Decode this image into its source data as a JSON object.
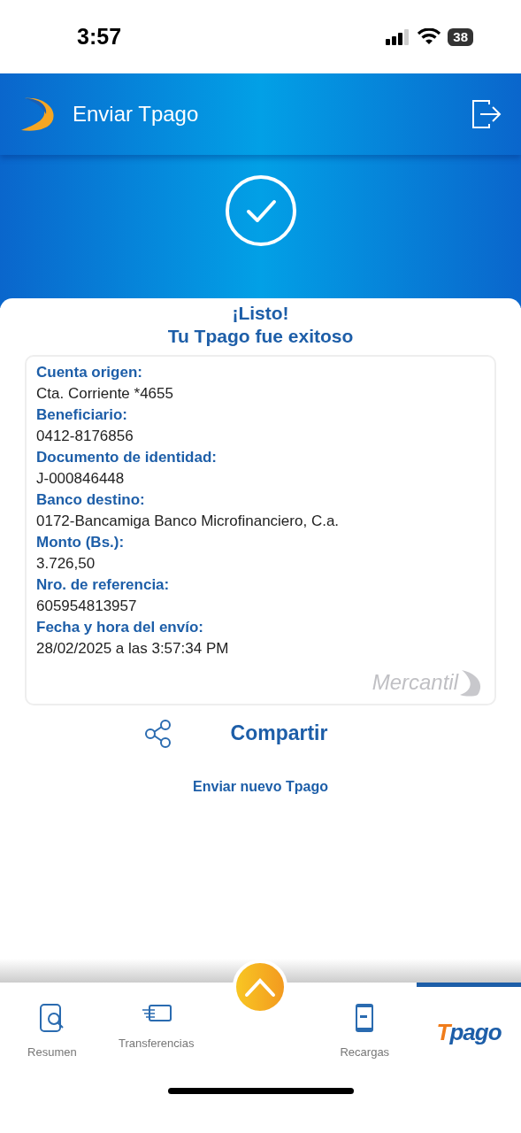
{
  "status_bar": {
    "time": "3:57",
    "battery": "38"
  },
  "header": {
    "title": "Enviar Tpago"
  },
  "result": {
    "heading": "¡Listo!",
    "subheading": "Tu Tpago fue exitoso"
  },
  "details": [
    {
      "label": "Cuenta origen:",
      "value": "Cta. Corriente *4655"
    },
    {
      "label": "Beneficiario:",
      "value": "0412-8176856"
    },
    {
      "label": "Documento de identidad:",
      "value": "J-000846448"
    },
    {
      "label": "Banco destino:",
      "value": "0172-Bancamiga Banco Microfinanciero, C.a."
    },
    {
      "label": "Monto (Bs.):",
      "value": "3.726,50"
    },
    {
      "label": "Nro. de referencia:",
      "value": "605954813957"
    },
    {
      "label": "Fecha y hora del envío:",
      "value": "28/02/2025 a las 3:57:34 PM"
    }
  ],
  "watermark_brand": "Mercantil",
  "share_button": "Compartir",
  "new_link": "Enviar nuevo Tpago",
  "tab_bar": [
    {
      "kind": "summary",
      "label": "Resumen",
      "selected": false
    },
    {
      "kind": "transfer",
      "label": "Transferencias",
      "selected": false
    },
    {
      "kind": "center",
      "selected": false
    },
    {
      "kind": "recharge",
      "label": "Recargas",
      "selected": false
    },
    {
      "kind": "logo",
      "label": "Tpago",
      "selected": true
    }
  ]
}
